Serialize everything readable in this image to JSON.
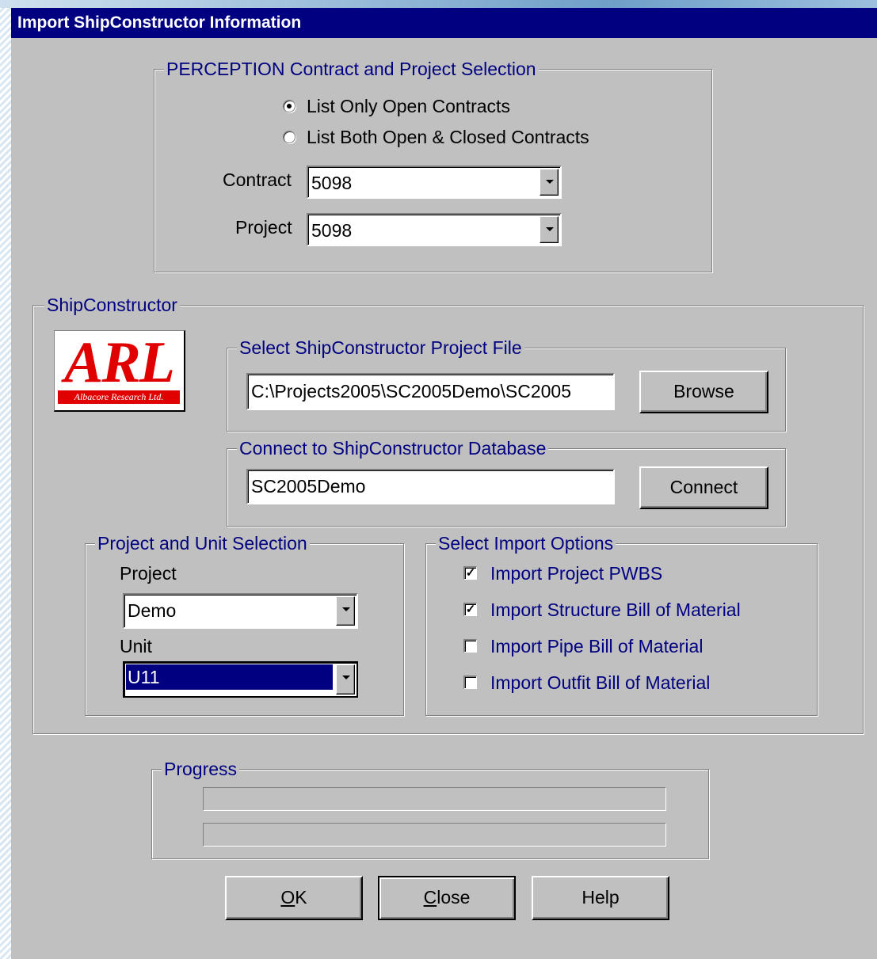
{
  "window": {
    "title": "Import ShipConstructor Information"
  },
  "perception": {
    "legend": "PERCEPTION Contract and Project Selection",
    "radio_open": "List Only Open Contracts",
    "radio_both": "List Both Open & Closed Contracts",
    "contract_label": "Contract",
    "contract_value": "5098",
    "project_label": "Project",
    "project_value": "5098"
  },
  "shipconstructor": {
    "legend": "ShipConstructor",
    "logo": {
      "main": "ARL",
      "sub": "Albacore Research Ltd."
    },
    "project_file": {
      "legend": "Select ShipConstructor Project File",
      "value": "C:\\Projects2005\\SC2005Demo\\SC2005",
      "browse_label": "Browse"
    },
    "database": {
      "legend": "Connect to ShipConstructor Database",
      "value": "SC2005Demo",
      "connect_label": "Connect"
    },
    "unit_selection": {
      "legend": "Project and Unit Selection",
      "project_label": "Project",
      "project_value": "Demo",
      "unit_label": "Unit",
      "unit_value": "U11"
    },
    "import_options": {
      "legend": "Select Import Options",
      "items": [
        {
          "label": "Import Project PWBS",
          "checked": true
        },
        {
          "label": "Import Structure Bill of Material",
          "checked": true
        },
        {
          "label": "Import Pipe Bill of Material",
          "checked": false
        },
        {
          "label": "Import Outfit Bill of Material",
          "checked": false
        }
      ]
    }
  },
  "progress": {
    "legend": "Progress",
    "bar1_value": 0,
    "bar2_value": 0
  },
  "buttons": {
    "ok": {
      "mnemonic": "O",
      "rest": "K"
    },
    "close": {
      "mnemonic": "C",
      "rest": "lose"
    },
    "help": "Help"
  }
}
